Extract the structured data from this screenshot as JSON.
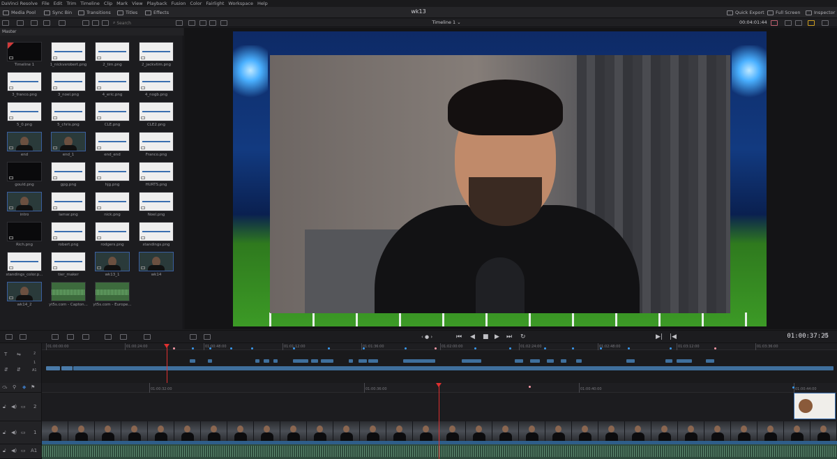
{
  "menu": [
    "DaVinci Resolve",
    "File",
    "Edit",
    "Trim",
    "Timeline",
    "Clip",
    "Mark",
    "View",
    "Playback",
    "Fusion",
    "Color",
    "Fairlight",
    "Workspace",
    "Help"
  ],
  "toolbar": {
    "media_pool": "Media Pool",
    "sync_bin": "Sync Bin",
    "transitions": "Transitions",
    "titles": "Titles",
    "effects": "Effects",
    "project_title": "wk13",
    "quick_export": "Quick Export",
    "full_screen": "Full Screen",
    "inspector": "Inspector"
  },
  "search": {
    "placeholder": "Search"
  },
  "viewer": {
    "timeline_name": "Timeline 1",
    "timecode_top": "00:04:01:44"
  },
  "media_pool": {
    "bin": "Master",
    "clips": [
      {
        "name": "Timeline 1",
        "type": "timeline"
      },
      {
        "name": "1_nickvsrobert.png",
        "type": "image"
      },
      {
        "name": "2_tim.png",
        "type": "image"
      },
      {
        "name": "2_jackvtim.png",
        "type": "image"
      },
      {
        "name": "3_franco.png",
        "type": "image"
      },
      {
        "name": "3_noel.png",
        "type": "image"
      },
      {
        "name": "4_eric.png",
        "type": "image"
      },
      {
        "name": "4_nogb.png",
        "type": "image"
      },
      {
        "name": "5_0.png",
        "type": "image"
      },
      {
        "name": "5_chris.png",
        "type": "image"
      },
      {
        "name": "CLE.png",
        "type": "image"
      },
      {
        "name": "CLE2.png",
        "type": "image"
      },
      {
        "name": "end",
        "type": "video"
      },
      {
        "name": "end_1",
        "type": "video"
      },
      {
        "name": "end_end",
        "type": "image"
      },
      {
        "name": "Franco.png",
        "type": "image"
      },
      {
        "name": "gould.png",
        "type": "dark"
      },
      {
        "name": "gpg.png",
        "type": "image"
      },
      {
        "name": "hjg.png",
        "type": "image"
      },
      {
        "name": "HURTS.png",
        "type": "image"
      },
      {
        "name": "intro",
        "type": "video"
      },
      {
        "name": "lamar.png",
        "type": "image"
      },
      {
        "name": "nick.png",
        "type": "image"
      },
      {
        "name": "Noel.png",
        "type": "image"
      },
      {
        "name": "Rich.png",
        "type": "dark"
      },
      {
        "name": "robert.png",
        "type": "image"
      },
      {
        "name": "rodgers.png",
        "type": "image"
      },
      {
        "name": "standings.png",
        "type": "image"
      },
      {
        "name": "standings_color.p...",
        "type": "image"
      },
      {
        "name": "tier_maker",
        "type": "image"
      },
      {
        "name": "wk13_1",
        "type": "video"
      },
      {
        "name": "wk14",
        "type": "video"
      },
      {
        "name": "wk14_2",
        "type": "video"
      },
      {
        "name": "yt5s.com - Capton...",
        "type": "audio"
      },
      {
        "name": "yt5s.com - Europe...",
        "type": "audio"
      }
    ]
  },
  "transport": {
    "timecode": "01:00:37:25"
  },
  "overview_ruler": [
    "01:00:00:00",
    "01:00:24:00",
    "01:00:48:00",
    "01:01:12:00",
    "01:01:36:00",
    "01:02:00:00",
    "01:02:24:00",
    "01:02:48:00",
    "01:03:12:00",
    "01:03:36:00"
  ],
  "track_ruler": [
    "01:00:32:00",
    "01:00:36:00",
    "01:00:40:00",
    "01:00:44:00"
  ],
  "tracks": {
    "v2": "2",
    "v1": "1",
    "a1": "A1"
  },
  "colors": {
    "accent": "#3a6fb0",
    "playhead": "#e03030",
    "clip_blue": "#3f6f9c",
    "audio_green": "#2e4a3c"
  }
}
